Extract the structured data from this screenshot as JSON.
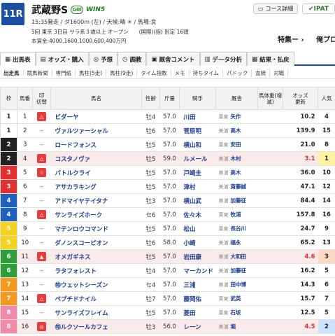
{
  "race": {
    "number": "11R",
    "name": "武蔵野S",
    "grade": "GIII",
    "win5": "WIN5",
    "line1": "15:35発走 / ダ1600m (左) / 天候:晴 ☀ / 馬場:良",
    "line2": "5回 東京 3日目 サラ系３歳以上 オープン　　(国際)(指) 別定 16頭",
    "line3": "本賞金:4000,1600,1000,600,400万円"
  },
  "header_buttons": {
    "course": "コース詳細",
    "ipat": "IPAT",
    "tokusyu": "特集ー ›",
    "orega": "俺プロ"
  },
  "tabs": [
    "出馬表",
    "オッズ・購入",
    "予想",
    "調教",
    "厩舎コメント",
    "データ分析",
    "結果・払戻"
  ],
  "subtabs": [
    "出走馬",
    "競馬新聞",
    "専門紙",
    "馬柱(5走)",
    "馬柱(9走)",
    "タイム指数",
    "メモ",
    "持ちタイム",
    "パドック",
    "血統",
    "対戦"
  ],
  "table_headers": {
    "waku": "枠",
    "umaban": "馬番",
    "mark": "印",
    "mark_sub": "切替",
    "horse": "馬名",
    "sexage": "性齢",
    "kinryo": "斤量",
    "jockey": "騎手",
    "trainer": "厩舎",
    "weight": "馬体重(増減)",
    "odds": "オッズ",
    "odds_btn": "更新",
    "ninki": "人気"
  },
  "colors": {
    "waku1": "#ffffff",
    "waku2": "#222222",
    "waku3": "#e23030",
    "waku4": "#1f5fbd",
    "waku5": "#f5d21e",
    "waku6": "#2f9e3a",
    "waku7": "#f39a1e",
    "waku8": "#f08aa8"
  },
  "rows": [
    {
      "waku": "1",
      "umaban": "1",
      "mark": "△",
      "horse": "ビダーヤ",
      "sexage": "牡4",
      "kinryo": "57.0",
      "jockey": "川田",
      "area": "栗東",
      "trainer": "矢作",
      "odds": "10.2",
      "ninki": "4"
    },
    {
      "waku": "1",
      "umaban": "2",
      "mark": "--",
      "horse": "ヴァルツァーシャル",
      "sexage": "牡6",
      "kinryo": "57.0",
      "jockey": "菅原明",
      "area": "美浦",
      "trainer": "高木",
      "odds": "139.9",
      "ninki": "15"
    },
    {
      "waku": "2",
      "umaban": "3",
      "mark": "--",
      "horse": "ロードフォンス",
      "sexage": "牡5",
      "kinryo": "57.0",
      "jockey": "横山和",
      "area": "栗東",
      "trainer": "安田",
      "odds": "21.0",
      "ninki": "8"
    },
    {
      "waku": "2",
      "umaban": "4",
      "mark": "△",
      "horse": "コスタノヴァ",
      "sexage": "牡5",
      "kinryo": "59.0",
      "jockey": "ルメール",
      "area": "美浦",
      "trainer": "木村",
      "odds": "3.1",
      "ninki": "1"
    },
    {
      "waku": "3",
      "umaban": "5",
      "mark": "☆",
      "horse": "バトルクライ",
      "sexage": "牡5",
      "kinryo": "57.0",
      "jockey": "戸崎圭",
      "area": "美浦",
      "trainer": "高木",
      "odds": "36.0",
      "ninki": "10"
    },
    {
      "waku": "3",
      "umaban": "6",
      "mark": "--",
      "horse": "アサカラキング",
      "sexage": "牡5",
      "kinryo": "57.0",
      "jockey": "津村",
      "area": "美浦",
      "trainer": "斎藤誠",
      "odds": "47.1",
      "ninki": "12"
    },
    {
      "waku": "4",
      "umaban": "7",
      "mark": "--",
      "horse": "アドマイヤテイタナ",
      "sexage": "牡3",
      "kinryo": "57.0",
      "jockey": "横山武",
      "area": "美浦",
      "trainer": "加藤征",
      "odds": "84.4",
      "ninki": "14"
    },
    {
      "waku": "4",
      "umaban": "8",
      "mark": "△",
      "horse": "サンライズホーク",
      "sexage": "セ6",
      "kinryo": "57.0",
      "jockey": "佐々木",
      "area": "栗東",
      "trainer": "牧浦",
      "odds": "157.8",
      "ninki": "16"
    },
    {
      "waku": "5",
      "umaban": "9",
      "mark": "--",
      "horse": "マテンロウコマンド",
      "sexage": "牡5",
      "kinryo": "57.0",
      "jockey": "松山",
      "area": "栗東",
      "trainer": "長谷川",
      "odds": "24.7",
      "ninki": "9"
    },
    {
      "waku": "5",
      "umaban": "10",
      "mark": "--",
      "horse": "ダノンスコーピオン",
      "sexage": "牡6",
      "kinryo": "58.0",
      "jockey": "小崎",
      "area": "美浦",
      "trainer": "福永",
      "odds": "65.2",
      "ninki": "13"
    },
    {
      "waku": "6",
      "umaban": "11",
      "mark": "▲",
      "horse": "オメガギネス",
      "sexage": "牡5",
      "kinryo": "57.0",
      "jockey": "岩田康",
      "area": "美浦",
      "trainer": "大和田",
      "odds": "4.6",
      "ninki": "3"
    },
    {
      "waku": "6",
      "umaban": "12",
      "mark": "--",
      "horse": "ラタフォレスト",
      "sexage": "牡4",
      "kinryo": "57.0",
      "jockey": "マーカンド",
      "area": "美浦",
      "trainer": "加藤征",
      "odds": "16.2",
      "ninki": "5"
    },
    {
      "waku": "7",
      "umaban": "13",
      "mark": "--",
      "horse": "㊕ウェットシーズン",
      "sexage": "セ4",
      "kinryo": "57.0",
      "jockey": "三浦",
      "area": "美浦",
      "trainer": "田中博",
      "odds": "14.3",
      "ninki": "6"
    },
    {
      "waku": "7",
      "umaban": "14",
      "mark": "△",
      "horse": "ペプチドナイル",
      "sexage": "牡7",
      "kinryo": "57.0",
      "jockey": "藤岡佑",
      "area": "栗東",
      "trainer": "武英",
      "odds": "15.7",
      "ninki": "7"
    },
    {
      "waku": "8",
      "umaban": "15",
      "mark": "--",
      "horse": "サンライズフレイム",
      "sexage": "牡5",
      "kinryo": "57.0",
      "jockey": "菱田",
      "area": "栗東",
      "trainer": "石坂",
      "odds": "12.5",
      "ninki": "5"
    },
    {
      "waku": "8",
      "umaban": "16",
      "mark": "◎",
      "horse": "㊕ルクソールカフェ",
      "sexage": "牡3",
      "kinryo": "56.0",
      "jockey": "レーン",
      "area": "美浦",
      "trainer": "堀",
      "odds": "4.5",
      "ninki": "2"
    }
  ]
}
